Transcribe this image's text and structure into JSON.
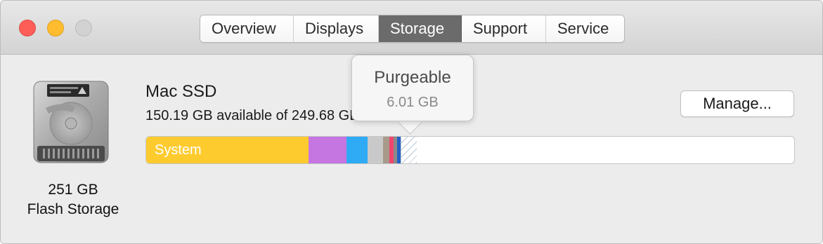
{
  "window": {
    "traffic_lights": [
      {
        "name": "close-button",
        "color": "#fd5e57"
      },
      {
        "name": "minimize-button",
        "color": "#febc2e"
      },
      {
        "name": "zoom-button",
        "color": "#d2d2d2"
      }
    ]
  },
  "tabs": [
    {
      "label": "Overview",
      "active": false
    },
    {
      "label": "Displays",
      "active": false
    },
    {
      "label": "Storage",
      "active": true
    },
    {
      "label": "Support",
      "active": false
    },
    {
      "label": "Service",
      "active": false
    }
  ],
  "disk": {
    "icon": "hard-drive-icon",
    "size_line1": "251 GB",
    "size_line2": "Flash Storage",
    "name": "Mac SSD",
    "available_text": "150.19 GB available of 249.68 GB"
  },
  "storage_bar": {
    "segments": [
      {
        "name": "system",
        "label": "System",
        "color": "#fecb2f",
        "fraction": 0.2505
      },
      {
        "name": "seg-purple",
        "label": "",
        "color": "#c576e0",
        "fraction": 0.0585
      },
      {
        "name": "seg-blue",
        "label": "",
        "color": "#2faaf5",
        "fraction": 0.0325
      },
      {
        "name": "seg-lightgray",
        "label": "",
        "color": "#c9c9c9",
        "fraction": 0.0238
      },
      {
        "name": "seg-tan",
        "label": "",
        "color": "#a8998a",
        "fraction": 0.0098
      },
      {
        "name": "seg-pink",
        "label": "",
        "color": "#f0466e",
        "fraction": 0.0065
      },
      {
        "name": "seg-gray",
        "label": "",
        "color": "#8a8a8a",
        "fraction": 0.0054
      },
      {
        "name": "seg-darkblue",
        "label": "",
        "color": "#2461c8",
        "fraction": 0.0054
      },
      {
        "name": "purgeable",
        "label": "",
        "color": "#b8c8d8",
        "fraction": 0.0238
      }
    ]
  },
  "tooltip": {
    "title": "Purgeable",
    "value": "6.01 GB"
  },
  "manage_button": {
    "label": "Manage..."
  }
}
